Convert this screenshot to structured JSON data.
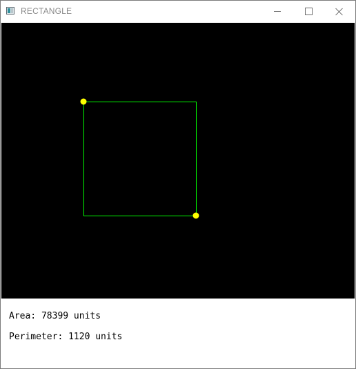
{
  "window": {
    "title": "RECTANGLE",
    "icon": "app-window-icon",
    "controls": [
      "minimize-icon",
      "maximize-icon",
      "close-icon"
    ]
  },
  "canvas": {
    "background": "#000000",
    "rectangle_color": "#00ff00",
    "vertex_color": "#ffff00"
  },
  "info": {
    "area_text": "Area: 78399 units",
    "perimeter_text": "Perimeter: 1120 units"
  }
}
